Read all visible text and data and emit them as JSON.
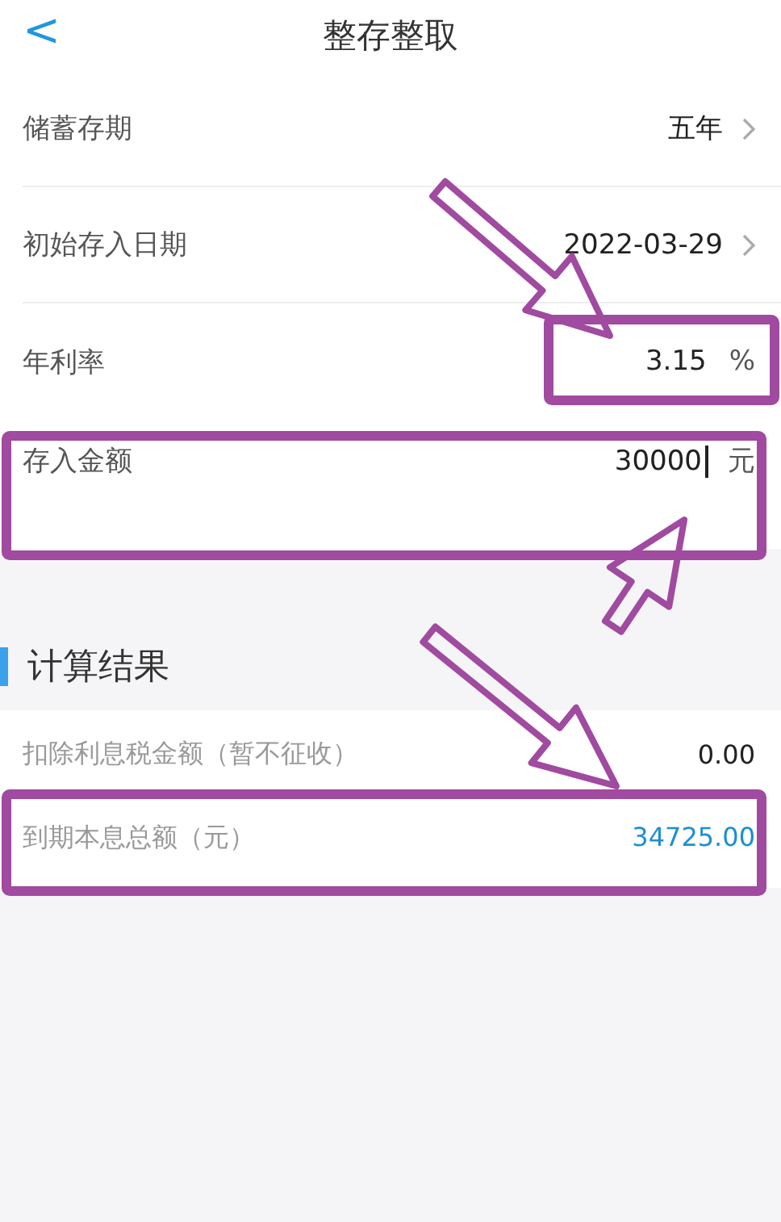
{
  "header": {
    "back": "<",
    "title": "整存整取"
  },
  "form": [
    {
      "kind": "select",
      "label": "储蓄存期",
      "value": "五年",
      "highlighted": false
    },
    {
      "kind": "select",
      "label": "初始存入日期",
      "value": "2022-03-29",
      "highlighted": false
    },
    {
      "kind": "input",
      "label": "年利率",
      "value": "3.15",
      "unit": "%",
      "focused": false,
      "highlighted": true
    },
    {
      "kind": "input",
      "label": "存入金额",
      "value": "30000",
      "unit": "元",
      "focused": true,
      "highlighted": true
    }
  ],
  "result": {
    "title": "计算结果",
    "rows": [
      {
        "label": "扣除利息税金额（暂不征收）",
        "value": "0.00",
        "emphasis": false,
        "highlighted": false
      },
      {
        "label": "到期本息总额（元）",
        "value": "34725.00",
        "emphasis": true,
        "highlighted": true
      }
    ]
  }
}
